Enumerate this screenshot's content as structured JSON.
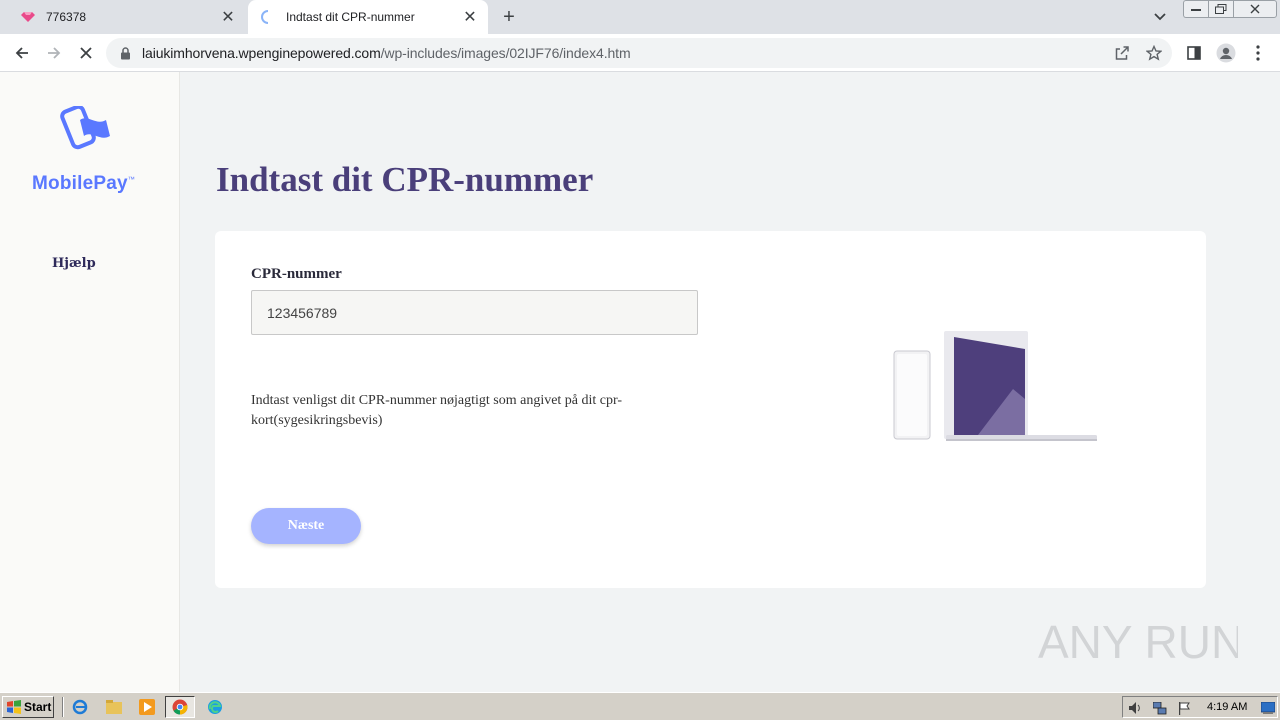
{
  "browser": {
    "tabs": [
      {
        "title": "776378",
        "active": false
      },
      {
        "title": "Indtast dit CPR-nummer",
        "active": true
      }
    ],
    "address": {
      "host": "laiukimhorvena.wpenginepowered.com",
      "path": "/wp-includes/images/02IJF76/index4.htm"
    }
  },
  "sidebar": {
    "brand": "MobilePay",
    "brand_tm": "™",
    "help": "Hjælp"
  },
  "main": {
    "title": "Indtast dit CPR-nummer",
    "field_label": "CPR-nummer",
    "cpr_value": "123456789",
    "hint": "Indtast venligst dit CPR-nummer nøjagtigt som angivet på dit cpr-kort(sygesikringsbevis)",
    "next_label": "Næste"
  },
  "watermark": "ANY RUN",
  "taskbar": {
    "start_label": "Start",
    "clock": "4:19 AM"
  },
  "colors": {
    "brand_blue": "#5a78ff",
    "title_purple": "#4a3f7a",
    "button": "#a5b4ff",
    "screen_purple": "#4e3f7c"
  }
}
